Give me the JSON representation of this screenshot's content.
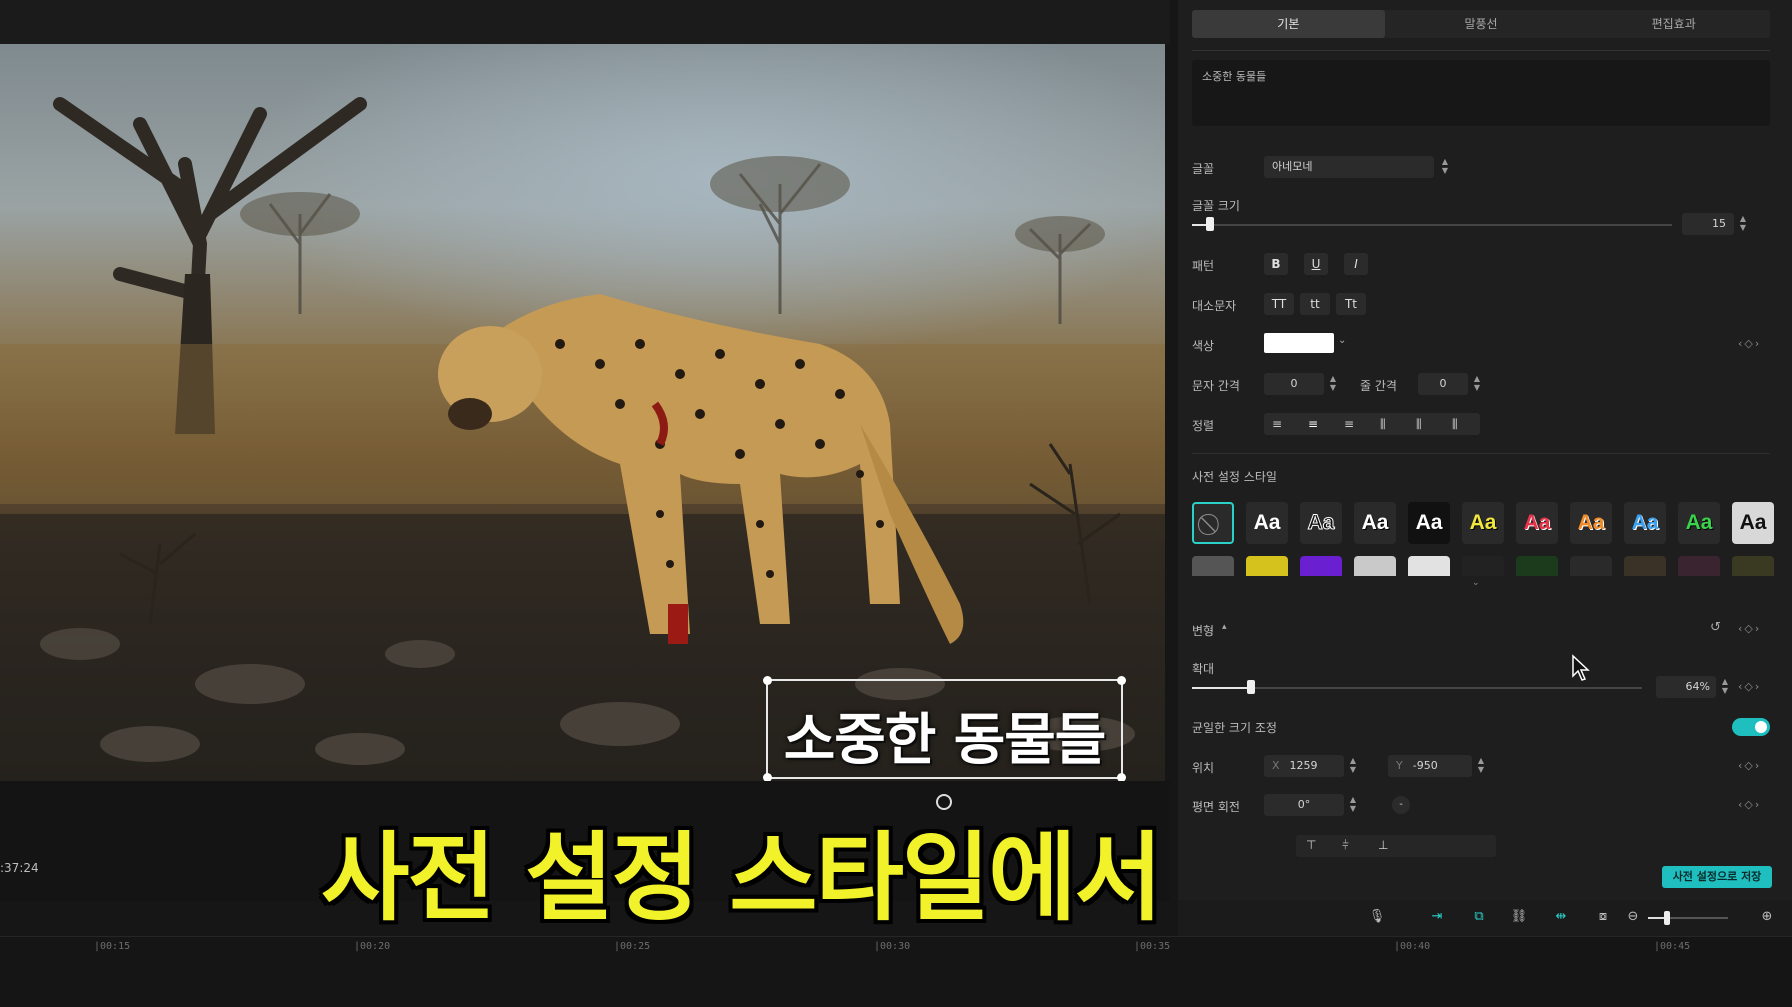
{
  "panel": {
    "tabs": [
      {
        "label": "기본",
        "active": true
      },
      {
        "label": "말풍선",
        "active": false
      },
      {
        "label": "편집효과",
        "active": false
      }
    ],
    "text_content": "소중한 동물들",
    "font_label": "글꼴",
    "font_value": "아네모네",
    "font_size_label": "글꼴 크기",
    "font_size_value": "15",
    "pattern_label": "패턴",
    "pattern_buttons": [
      "B",
      "U",
      "I"
    ],
    "case_label": "대소문자",
    "case_buttons": [
      "TT",
      "tt",
      "Tt"
    ],
    "color_label": "색상",
    "color_value": "#ffffff",
    "letter_spacing_label": "문자 간격",
    "letter_spacing_value": "0",
    "line_spacing_label": "줄 간격",
    "line_spacing_value": "0",
    "align_label": "정렬",
    "preset_label": "사전 설정 스타일",
    "preset_aa": "Aa",
    "transform_label": "변형",
    "scale_label": "확대",
    "scale_value": "64%",
    "scale_fraction": 0.13,
    "uniform_scale_label": "균일한 크기 조정",
    "uniform_scale_on": true,
    "position_label": "위치",
    "x_axis": "X",
    "x_value": "1259",
    "y_axis": "Y",
    "y_value": "-950",
    "rotation_label": "평면 회전",
    "rotation_value": "0°",
    "rotation_dash": "-",
    "save_preset_label": "사전 설정으로 저장"
  },
  "preview": {
    "overlay_text": "소중한 동물들",
    "timecode": ":37:24"
  },
  "caption": "사전 설정 스타일에서",
  "timeline": {
    "ticks": [
      "|00:15",
      "|00:20",
      "|00:25",
      "|00:30",
      "|00:35",
      "|00:40",
      "|00:45"
    ]
  },
  "colors": {
    "accent": "#1fbfbf",
    "caption": "#f2f22a"
  }
}
